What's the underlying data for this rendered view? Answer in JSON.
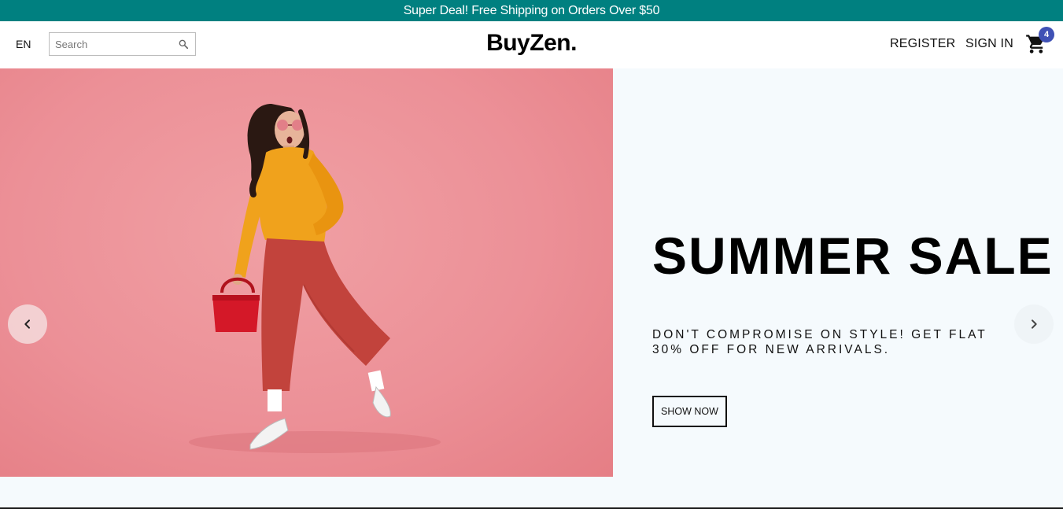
{
  "announcement": {
    "text": "Super Deal! Free Shipping on Orders Over $50",
    "bg_color": "#008080"
  },
  "navbar": {
    "language": "EN",
    "search": {
      "placeholder": "Search",
      "value": "",
      "icon": "search-icon"
    },
    "logo": "BuyZen.",
    "register_label": "REGISTER",
    "signin_label": "SIGN IN",
    "cart": {
      "icon": "shopping-cart-icon",
      "badge_count": "4",
      "badge_color": "#3f51b5"
    }
  },
  "slider": {
    "title": "SUMMER SALE",
    "description": "DON'T COMPROMISE ON STYLE! GET FLAT 30% OFF FOR NEW ARRIVALS.",
    "button_label": "SHOW NOW",
    "image_bg_color": "#ec9097",
    "prev_icon": "chevron-left-icon",
    "next_icon": "chevron-right-icon"
  }
}
